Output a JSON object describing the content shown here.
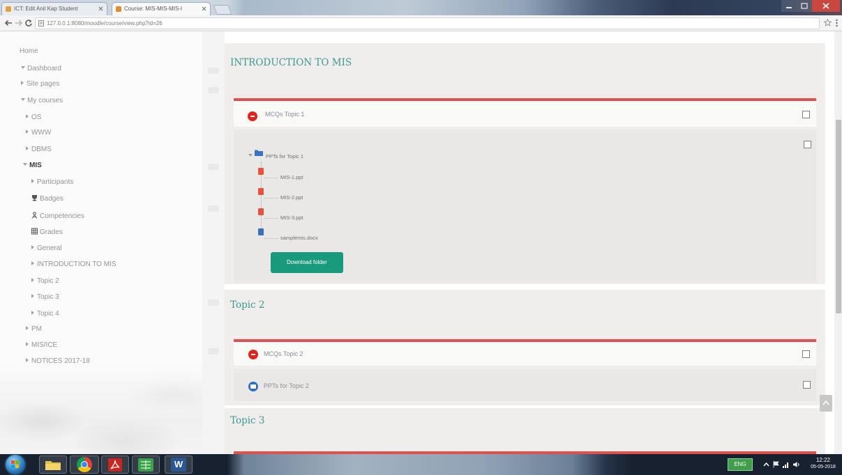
{
  "browser": {
    "tabs": [
      {
        "label": "ICT: Edit Anil Kap Student",
        "active": false
      },
      {
        "label": "Course: MIS-MIS-MIS-I",
        "active": true
      }
    ],
    "address_url": "127.0.0.1:8080/moodle/course/view.php?id=26",
    "icons": [
      "back-icon",
      "forward-icon",
      "reload-icon",
      "bookmark-star-icon",
      "menu-dots-icon"
    ]
  },
  "sidebar": {
    "items": [
      {
        "label": "Home"
      },
      {
        "label": "Dashboard",
        "state": "expanded"
      },
      {
        "label": "Site pages",
        "state": "collapsed"
      },
      {
        "label": "My courses",
        "state": "expanded"
      },
      {
        "label": "OS",
        "state": "collapsed"
      },
      {
        "label": "WWW",
        "state": "collapsed"
      },
      {
        "label": "DBMS",
        "state": "collapsed"
      },
      {
        "label": "MIS",
        "state": "expanded"
      },
      {
        "label": "Participants",
        "state": "collapsed"
      },
      {
        "label": "Badges",
        "icon": "trophy-icon"
      },
      {
        "label": "Competencies",
        "icon": "competencies-icon"
      },
      {
        "label": "Grades",
        "icon": "grades-table-icon"
      },
      {
        "label": "General",
        "state": "collapsed"
      },
      {
        "label": "INTRODUCTION TO MIS",
        "state": "collapsed"
      },
      {
        "label": "Topic 2",
        "state": "collapsed"
      },
      {
        "label": "Topic 3",
        "state": "collapsed"
      },
      {
        "label": "Topic 4",
        "state": "collapsed"
      },
      {
        "label": "PM",
        "state": "collapsed"
      },
      {
        "label": "MIS/ICE",
        "state": "collapsed"
      },
      {
        "label": "NOTICES 2017-18",
        "state": "collapsed"
      }
    ]
  },
  "course": {
    "sections": [
      {
        "title": "INTRODUCTION TO MIS",
        "activities": [
          {
            "label": "MCQs Topic 1",
            "icon": "quiz-icon"
          }
        ],
        "folder": {
          "label": "PPTs for Topic 1",
          "icon": "folder-icon",
          "state": "expanded",
          "files": [
            {
              "name": "MIS-1.ppt",
              "icon": "powerpoint-file-icon"
            },
            {
              "name": "MIS-2.ppt",
              "icon": "powerpoint-file-icon"
            },
            {
              "name": "MIS-3.ppt",
              "icon": "powerpoint-file-icon"
            },
            {
              "name": "samplemis.docx",
              "icon": "word-file-icon"
            }
          ],
          "download_button": "Download folder"
        }
      },
      {
        "title": "Topic 2",
        "activities": [
          {
            "label": "MCQs Topic 2",
            "icon": "quiz-icon"
          },
          {
            "label": "PPTs for Topic 2",
            "icon": "folder-icon"
          }
        ]
      },
      {
        "title": "Topic 3",
        "activities": []
      }
    ]
  },
  "taskbar": {
    "pinned": [
      "file-explorer-icon",
      "chrome-icon",
      "acrobat-icon",
      "green-app-icon",
      "word-icon"
    ],
    "word_logo_letter": "W",
    "tray": {
      "language": "ENG",
      "time": "12:22",
      "date": "05-05-2018"
    }
  },
  "colors": {
    "section_title_teal": "#3e978f",
    "download_button_green": "#1a9a7c",
    "section_divider_red": "#e0504c",
    "quiz_icon_red": "#e0231b",
    "folder_icon_blue": "#2f6fc4"
  }
}
